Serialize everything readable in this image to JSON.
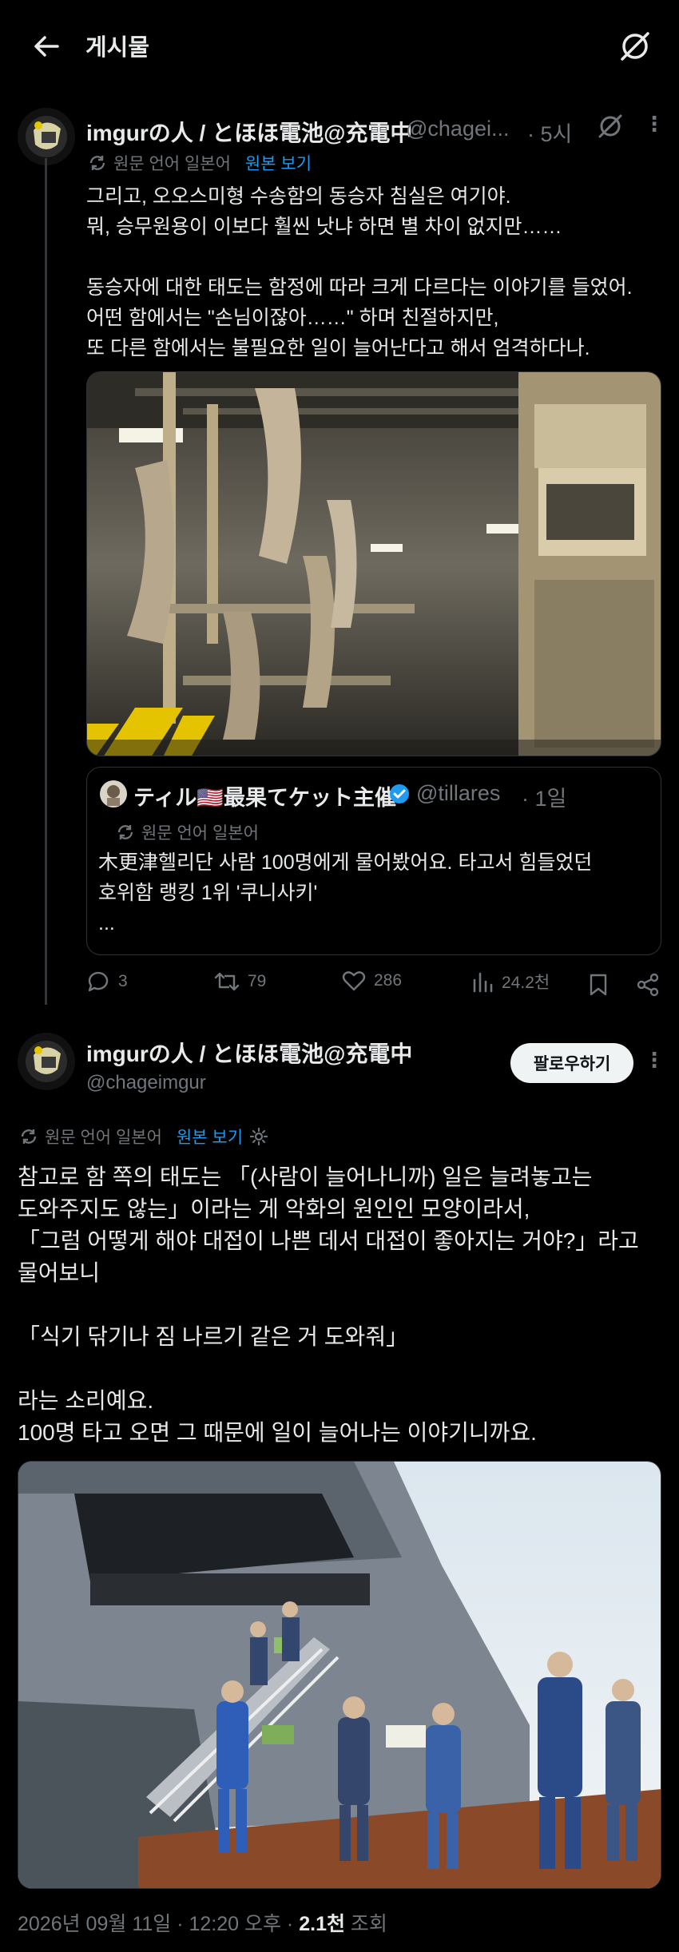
{
  "header": {
    "title": "게시물"
  },
  "post1": {
    "name": "imgurの人 / とほほ電池@充電中",
    "handle": "@chagei...",
    "time": "· 5시",
    "translation_note": "원문 언어 일본어",
    "show_original": "원본 보기",
    "text": "그리고, 오오스미형 수송함의 동승자 침실은 여기야.\n뭐, 승무원용이 이보다 훨씬 낫냐 하면 별 차이 없지만……\n\n동승자에 대한 태도는 함정에 따라 크게 다르다는 이야기를 들었어.\n어떤 함에서는 \"손님이잖아……\" 하며 친절하지만,\n또 다른 함에서는 불필요한 일이 늘어난다고 해서 엄격하다나."
  },
  "quote": {
    "name": "ティル🇺🇸最果てケット主催",
    "handle": "@tillares",
    "time": "· 1일",
    "translation_note": "원문 언어 일본어",
    "text": "木更津헬리단 사람 100명에게 물어봤어요. 타고서 힘들었던\n호위함 랭킹 1위 '쿠니사키'\n..."
  },
  "actions": {
    "replies": "3",
    "reposts": "79",
    "likes": "286",
    "views": "24.2천"
  },
  "post2": {
    "name": "imgurの人 / とほほ電池@充電中",
    "handle": "@chageimgur",
    "follow_label": "팔로우하기",
    "translation_note": "원문 언어 일본어",
    "show_original": "원본 보기",
    "text": "참고로 함 쪽의 태도는 「(사람이 늘어나니까) 일은 늘려놓고는\n도와주지도 않는」이라는 게 악화의 원인인 모양이라서,\n「그럼 어떻게 해야 대접이 나쁜 데서 대접이 좋아지는 거야?」라고\n물어보니\n\n「식기 닦기나 짐 나르기 같은 거 도와줘」\n\n라는 소리예요.\n100명 타고 오면 그 때문에 일이 늘어나는 이야기니까요.",
    "date": "2026년 09월 11일 · 12:20 오후 · ",
    "views_count": "2.1천",
    "views_label": " 조회"
  },
  "colors": {
    "accent": "#1d9bf0",
    "muted": "#71767b",
    "text": "#e7e9ea",
    "verified": "#1d9bf0"
  }
}
